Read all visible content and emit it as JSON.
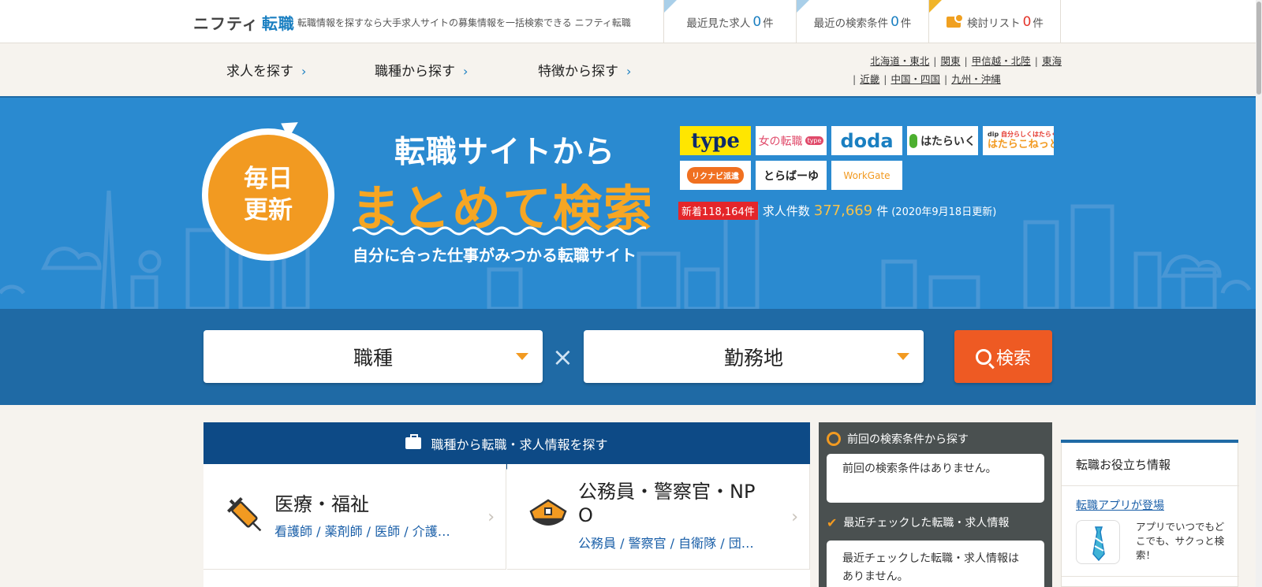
{
  "header": {
    "logo_main": "ニフティ",
    "logo_accent": "転職",
    "tagline": "転職情報を探すなら大手求人サイトの募集情報を一括検索できる ニフティ転職",
    "recent_jobs": {
      "label": "最近見た求人",
      "count": "0",
      "unit": "件"
    },
    "recent_searches": {
      "label": "最近の検索条件",
      "count": "0",
      "unit": "件"
    },
    "saved_list": {
      "label": "検討リスト",
      "count": "0",
      "unit": "件"
    }
  },
  "nav": {
    "items": [
      "求人を探す",
      "職種から探す",
      "特徴から探す"
    ],
    "chevron": "›",
    "regions_row1": [
      "北海道・東北",
      "関東",
      "甲信越・北陸",
      "東海"
    ],
    "regions_row2": [
      "近畿",
      "中国・四国",
      "九州・沖縄"
    ]
  },
  "hero": {
    "badge_line1": "毎日",
    "badge_line2": "更新",
    "line1": "転職サイトから",
    "line2": "まとめて検索",
    "line3": "自分に合った仕事がみつかる転職サイト",
    "partners": [
      "type",
      "女の転職",
      "doda",
      "はたらいく",
      "はたらこねっと",
      "リクナビ派遣",
      "とらばーゆ",
      "WorkGate"
    ],
    "partner_extra": {
      "type_badge": "type",
      "dip": "dip",
      "dip_tag": "自分らしくはたらく"
    },
    "new_badge": "新着118,164件",
    "count_label": "求人件数",
    "count_value": "377,669",
    "count_unit": "件",
    "updated": "(2020年9月18日更新)"
  },
  "search": {
    "job_select": "職種",
    "times": "×",
    "location_select": "勤務地",
    "button_label": "検索"
  },
  "category_section": {
    "title": "職種から転職・求人情報を探す",
    "cells": [
      {
        "title": "医療・福祉",
        "sub": "看護師 / 薬剤師 / 医師 / 介護…"
      },
      {
        "title_line1": "公務員・警察官・NP",
        "title_line2": "O",
        "sub": "公務員 / 警察官 / 自衛隊 / 団…"
      }
    ],
    "arrow": "›"
  },
  "history": {
    "last_search_title": "前回の検索条件から探す",
    "last_search_empty": "前回の検索条件はありません。",
    "recent_check_title": "最近チェックした転職・求人情報",
    "recent_check_empty": "最近チェックした転職・求人情報はありません。"
  },
  "tips": {
    "title": "転職お役立ち情報",
    "link": "転職アプリが登場",
    "app_text": "アプリでいつでもどこでも、サクっと検索！"
  },
  "colors": {
    "hero_blue": "#2a8ad0",
    "band_blue": "#1f6aa5",
    "navy": "#0d4a86",
    "orange": "#f29a21",
    "search_orange": "#ee5a23",
    "red": "#e4342a"
  }
}
